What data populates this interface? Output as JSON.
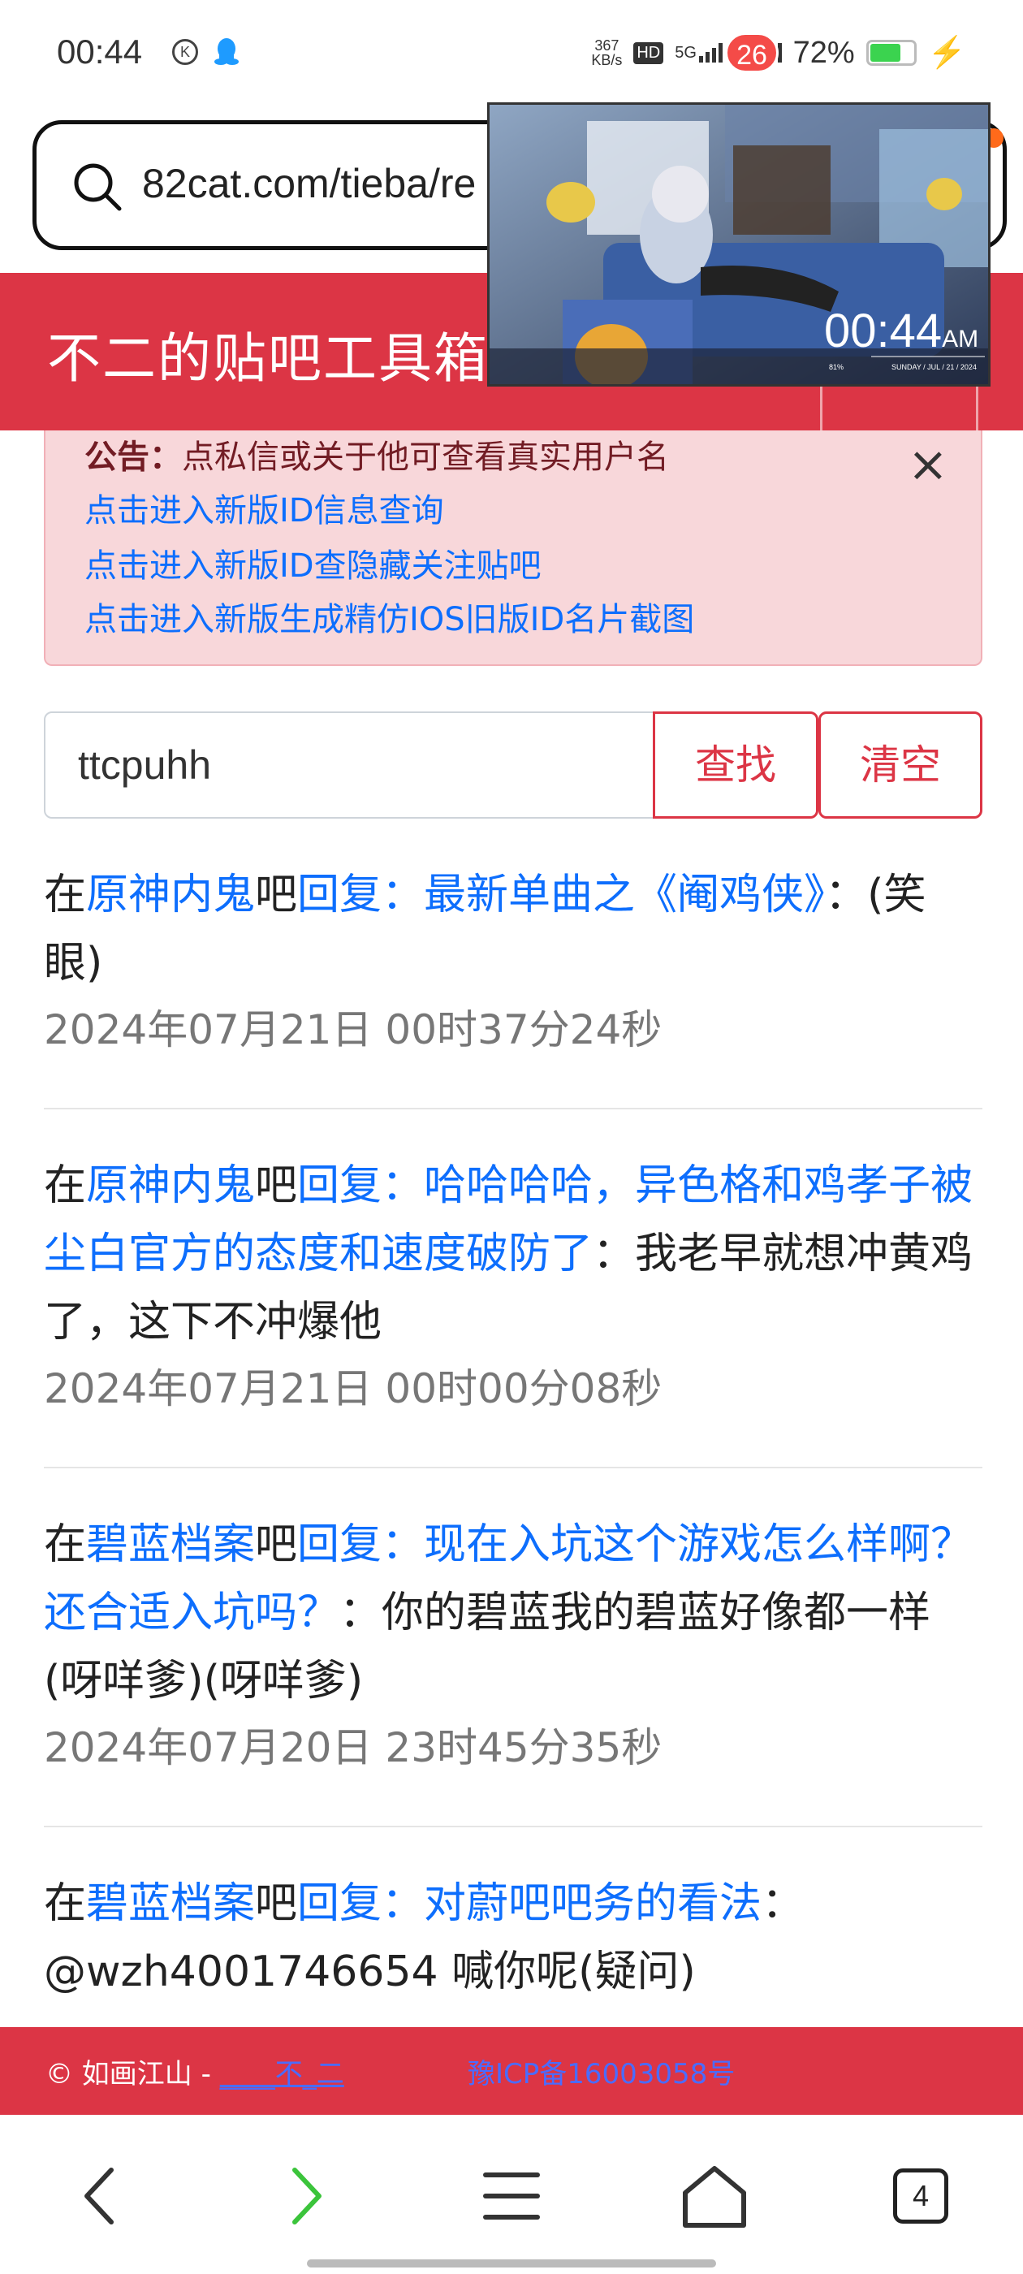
{
  "status_bar": {
    "time": "00:44",
    "circle_icon_letter": "K",
    "net_speed_value": "367",
    "net_speed_unit": "KB/s",
    "hd_label": "HD",
    "sim1": "5G",
    "sim2": "5G",
    "battery_pct": "72%",
    "battery_level": 0.72,
    "icons": [
      "k-circle-icon",
      "qq-penguin-icon",
      "hd-icon",
      "signal-icon",
      "battery-icon",
      "charging-bolt-icon"
    ]
  },
  "browser": {
    "url": "82cat.com/tieba/re",
    "tab_count": "4",
    "home_badge": "26",
    "nav_icons": [
      "back-arrow-icon",
      "forward-arrow-icon",
      "menu-icon",
      "home-icon",
      "tabs-icon"
    ],
    "colors": {
      "forward_arrow": "#3bc43b",
      "badge": "#f44b48"
    }
  },
  "video_overlay": {
    "clock": "00:44",
    "ampm": "AM",
    "date": "SUNDAY / JUL / 21 / 2024",
    "battery": "81%"
  },
  "site": {
    "title": "不二的贴吧工具箱",
    "accent_color": "#dc3545",
    "notice": {
      "label": "公告：",
      "text": "点私信或关于他可查看真实用户名",
      "links": [
        "点击进入新版ID信息查询",
        "点击进入新版ID查隐藏关注贴吧",
        "点击进入新版生成精仿IOS旧版ID名片截图"
      ],
      "close": "×"
    },
    "search": {
      "value": "ttcpuhh",
      "find_label": "查找",
      "clear_label": "清空"
    },
    "results": [
      {
        "prefix": "在",
        "forum": "原神内鬼",
        "ba": "吧",
        "title": "回复：最新单曲之《阉鸡侠》",
        "sep": "：",
        "content": "(笑眼)",
        "time": "2024年07月21日 00时37分24秒"
      },
      {
        "prefix": "在",
        "forum": "原神内鬼",
        "ba": "吧",
        "title": "回复：哈哈哈哈，异色格和鸡孝子被尘白官方的态度和速度破防了",
        "sep": "：",
        "content": "我老早就想冲黄鸡了，这下不冲爆他",
        "time": "2024年07月21日 00时00分08秒"
      },
      {
        "prefix": "在",
        "forum": "碧蓝档案",
        "ba": "吧",
        "title": "回复：现在入坑这个游戏怎么样啊？还合适入坑吗？",
        "sep": "：",
        "content": "你的碧蓝我的碧蓝好像都一样(呀咩爹)(呀咩爹)",
        "time": "2024年07月20日 23时45分35秒"
      },
      {
        "prefix": "在",
        "forum": "碧蓝档案",
        "ba": "吧",
        "title": "回复：对蔚吧吧务的看法",
        "sep": "：",
        "content": "@wzh4001746654 喊你呢(疑问)",
        "time": ""
      }
    ],
    "footer": {
      "copyright": "© 如画江山 - ",
      "author": "____不_二",
      "icp": "豫ICP备16003058号"
    }
  }
}
